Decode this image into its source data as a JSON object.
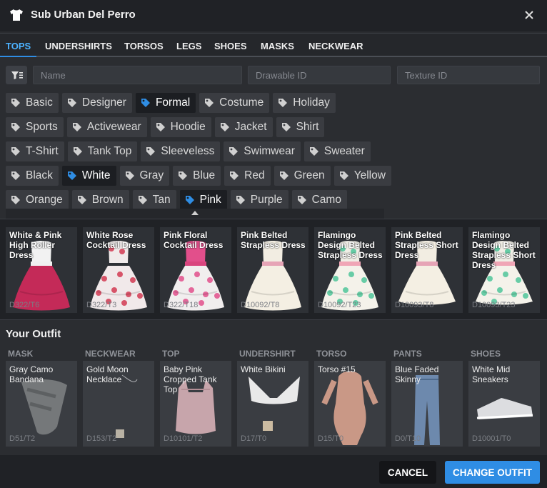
{
  "window": {
    "title": "Sub Urban Del Perro",
    "icon": "tshirt-icon",
    "close_icon": "close-icon"
  },
  "tabs": [
    {
      "label": "TOPS",
      "active": true
    },
    {
      "label": "UNDERSHIRTS"
    },
    {
      "label": "TORSOS"
    },
    {
      "label": "LEGS"
    },
    {
      "label": "SHOES"
    },
    {
      "label": "MASKS"
    },
    {
      "label": "NECKWEAR"
    }
  ],
  "search": {
    "filter_icon": "filter-icon",
    "name_placeholder": "Name",
    "drawable_placeholder": "Drawable ID",
    "texture_placeholder": "Texture ID"
  },
  "tags": {
    "rows": [
      [
        {
          "label": "Basic"
        },
        {
          "label": "Designer"
        },
        {
          "label": "Formal",
          "selected": true
        },
        {
          "label": "Costume"
        },
        {
          "label": "Holiday"
        }
      ],
      [
        {
          "label": "Sports"
        },
        {
          "label": "Activewear"
        },
        {
          "label": "Hoodie"
        },
        {
          "label": "Jacket"
        },
        {
          "label": "Shirt"
        }
      ],
      [
        {
          "label": "T-Shirt"
        },
        {
          "label": "Tank Top"
        },
        {
          "label": "Sleeveless"
        },
        {
          "label": "Swimwear"
        },
        {
          "label": "Sweater"
        }
      ],
      [
        {
          "label": "Black"
        },
        {
          "label": "White",
          "selected": true
        },
        {
          "label": "Gray"
        },
        {
          "label": "Blue"
        },
        {
          "label": "Red"
        },
        {
          "label": "Green"
        },
        {
          "label": "Yellow"
        }
      ],
      [
        {
          "label": "Orange"
        },
        {
          "label": "Brown"
        },
        {
          "label": "Tan"
        },
        {
          "label": "Pink",
          "selected": true
        },
        {
          "label": "Purple"
        },
        {
          "label": "Camo"
        }
      ]
    ],
    "icon": "tag-icon",
    "selected_color": "#2f8de4"
  },
  "results": [
    {
      "name": "White & Pink High Roller Dress",
      "code": "D322/T6"
    },
    {
      "name": "White Rose Cocktail Dress",
      "code": "D322/T3"
    },
    {
      "name": "Pink Floral Cocktail Dress",
      "code": "D322/T18"
    },
    {
      "name": "Pink Belted Strapless Dress",
      "code": "D10092/T8"
    },
    {
      "name": "Flamingo Design Belted Strapless Dress",
      "code": "D10092/T23"
    },
    {
      "name": "Pink Belted Strapless Short Dress",
      "code": "D10093/T8"
    },
    {
      "name": "Flamingo Design Belted Strapless Short Dress",
      "code": "D10093/T23"
    }
  ],
  "outfit": {
    "heading": "Your Outfit",
    "slots": [
      {
        "category": "MASK",
        "name": "Gray Camo Bandana",
        "code": "D51/T2"
      },
      {
        "category": "NECKWEAR",
        "name": "Gold Moon Necklace",
        "code": "D153/T2"
      },
      {
        "category": "TOP",
        "name": "Baby Pink Cropped Tank Top",
        "code": "D10101/T2"
      },
      {
        "category": "UNDERSHIRT",
        "name": "White Bikini",
        "code": "D17/T0"
      },
      {
        "category": "TORSO",
        "name": "Torso #15",
        "code": "D15/T0"
      },
      {
        "category": "PANTS",
        "name": "Blue Faded Skinny",
        "code": "D0/T10"
      },
      {
        "category": "SHOES",
        "name": "White Mid Sneakers",
        "code": "D10001/T0"
      }
    ]
  },
  "footer": {
    "cancel_label": "CANCEL",
    "change_label": "CHANGE OUTFIT"
  },
  "colors": {
    "accent": "#2f8de4",
    "background": "#2b2d31",
    "panel": "#202226"
  }
}
